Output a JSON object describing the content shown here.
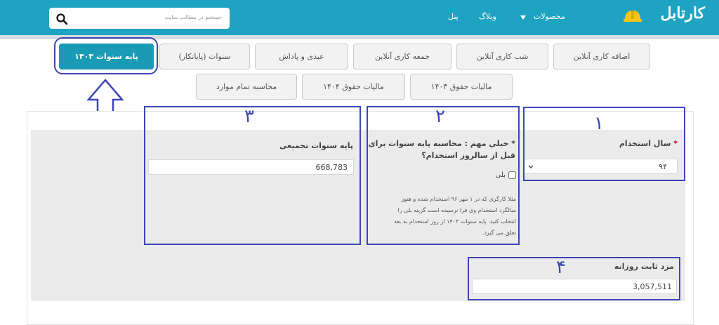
{
  "header": {
    "search_placeholder": "جستجو در مطالب سایت",
    "nav": [
      "محصولات",
      "وبلاگ",
      "پنل"
    ],
    "logo_text": "کارتابل",
    "accent": "#1fa3c2"
  },
  "tabs_row1": [
    "اضافه کاری آنلاین",
    "شب کاری آنلاین",
    "جمعه کاری آنلاین",
    "عیدی و پاداش",
    "سنوات (پایانکار)",
    "پایه سنوات ۱۴۰۳"
  ],
  "tabs_row2": [
    "مالیات حقوق ۱۴۰۳",
    "مالیات حقوق ۱۴۰۴",
    "محاسبه تمام موارد"
  ],
  "form": {
    "year_label": "سال استخدام",
    "required_mark": "*",
    "year_value": "۹۴",
    "important_title": "* خیلی مهم : محاسبه پایه سنوات برای قبل از سالروز استخدام؟",
    "yes_label": "بلی",
    "note_lines": [
      "مثلا کارگری که در ۱ مهر ۹۶ استخدام شده و هنوز",
      "سالگرد استخدام وی فرا نرسیده است گزینه بلی را",
      "انتخاب کنید. پایه سنوات ۱۴۰۳ از روز استخدام به بعد",
      "تعلق می گیرد."
    ],
    "cumulative_label": "پایه سنوات تجمیعی",
    "cumulative_value": "668,783",
    "daily_wage_label": "مزد ثابت روزانه",
    "daily_wage_value": "3,057,511"
  },
  "annotations": [
    "۱",
    "۲",
    "۳",
    "۴"
  ],
  "annotation_color": "#3c45b7"
}
